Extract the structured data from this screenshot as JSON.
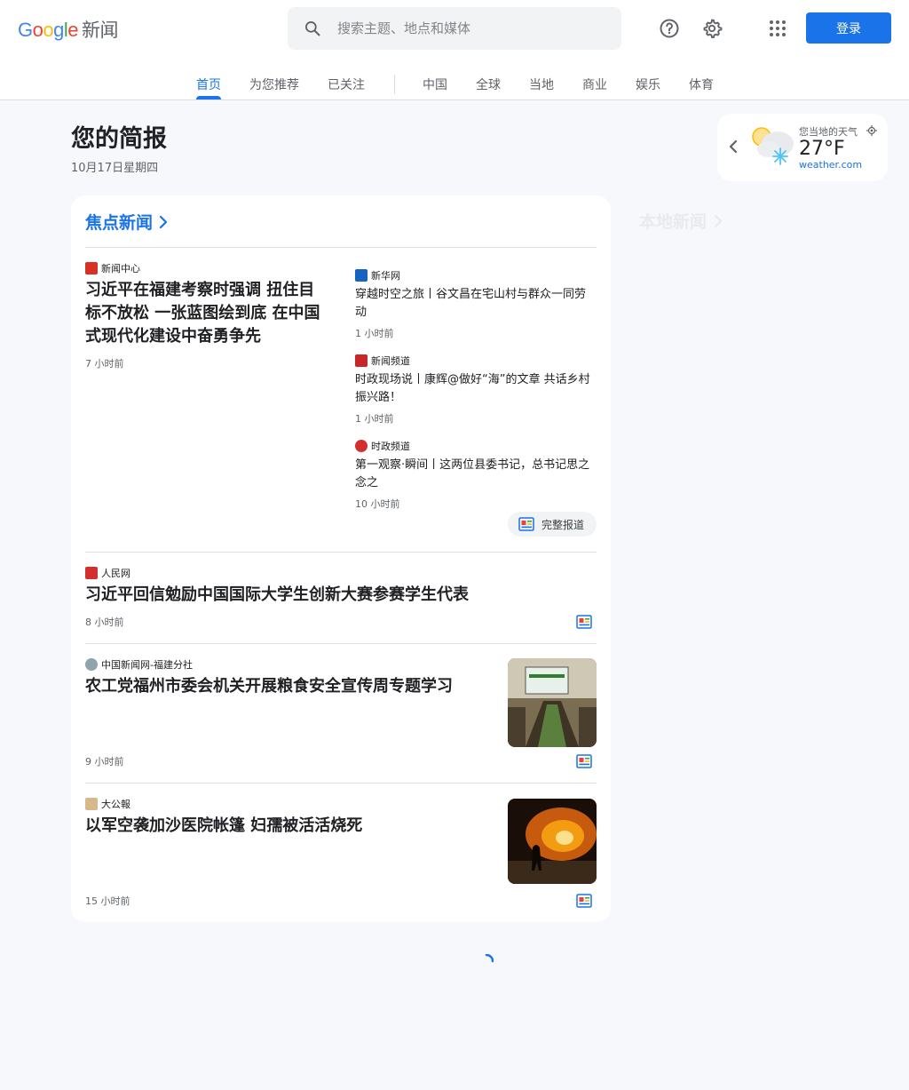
{
  "header": {
    "logo_letters": [
      "G",
      "o",
      "o",
      "g",
      "l",
      "e"
    ],
    "logo_suffix": "新闻",
    "search_placeholder": "搜索主题、地点和媒体",
    "signin_label": "登录"
  },
  "tabs": [
    {
      "label": "首页",
      "active": true
    },
    {
      "label": "为您推荐"
    },
    {
      "label": "已关注"
    },
    {
      "label": "中国"
    },
    {
      "label": "全球"
    },
    {
      "label": "当地"
    },
    {
      "label": "商业"
    },
    {
      "label": "娱乐"
    },
    {
      "label": "体育"
    }
  ],
  "briefing": {
    "title": "您的简报",
    "date": "10月17日星期四"
  },
  "weather": {
    "label": "您当地的天气",
    "temp": "27°F",
    "source": "weather.com"
  },
  "top_stories": {
    "title": "焦点新闻",
    "lead": {
      "source": "新闻中心",
      "headline": "习近平在福建考察时强调 扭住目标不放松 一张蓝图绘到底 在中国式现代化建设中奋勇争先",
      "time": "7 小时前"
    },
    "related": [
      {
        "source": "新华网",
        "headline": "穿越时空之旅丨谷文昌在宅山村与群众一同劳动",
        "time": "1 小时前"
      },
      {
        "source": "新闻频道",
        "headline": "时政现场说丨康辉@做好“海”的文章 共话乡村振兴路！",
        "time": "1 小时前"
      },
      {
        "source": "时政频道",
        "headline": "第一观察·瞬间丨这两位县委书记，总书记思之念之",
        "time": "10 小时前"
      }
    ],
    "full_coverage": "完整报道",
    "articles": [
      {
        "source": "人民网",
        "headline": "习近平回信勉励中国国际大学生创新大赛参赛学生代表",
        "time": "8 小时前"
      },
      {
        "source": "中国新闻网-福建分社",
        "headline": "农工党福州市委会机关开展粮食安全宣传周专题学习",
        "time": "9 小时前"
      },
      {
        "source": "大公報",
        "headline": "以军空袭加沙医院帐篷 妇孺被活活烧死",
        "time": "15 小时前"
      }
    ]
  },
  "local_news": {
    "title": "本地新闻"
  },
  "colors": {
    "accent": "#1a73e8",
    "background": "#f6f8fc"
  }
}
